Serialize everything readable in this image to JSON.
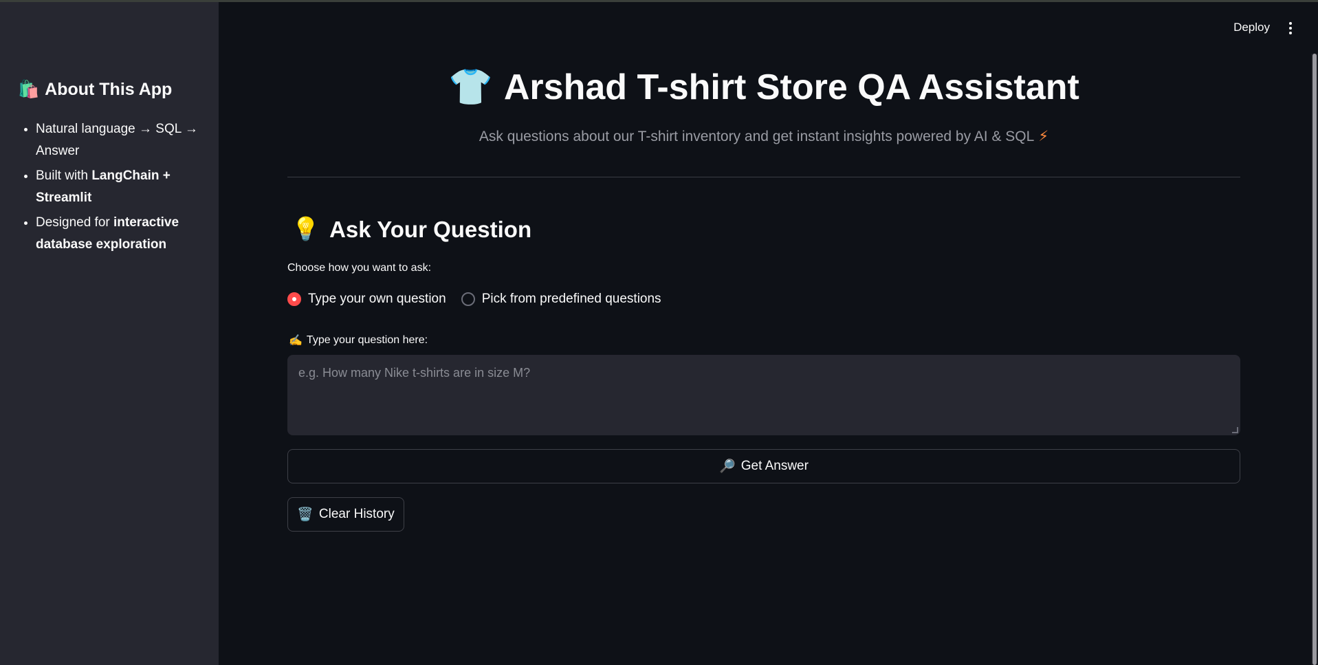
{
  "sidebar": {
    "title_icon": "🛍️",
    "title": "About This App",
    "items": [
      {
        "text": "Natural language → SQL → Answer",
        "bold": ""
      },
      {
        "text": "Built with ",
        "bold": "LangChain + Streamlit"
      },
      {
        "text": "Designed for ",
        "bold": "interactive database exploration"
      }
    ]
  },
  "header": {
    "deploy_label": "Deploy",
    "menu_icon": "kebab-menu-icon"
  },
  "main": {
    "title_icon": "👕",
    "title": "Arshad T-shirt Store QA Assistant",
    "subtitle": "Ask questions about our T-shirt inventory and get instant insights powered by AI & SQL",
    "subtitle_icon": "⚡",
    "section_icon": "💡",
    "section_title": "Ask Your Question",
    "radio_label": "Choose how you want to ask:",
    "radio_options": [
      {
        "label": "Type your own question",
        "selected": true
      },
      {
        "label": "Pick from predefined questions",
        "selected": false
      }
    ],
    "input_icon": "✍️",
    "input_label": "Type your question here:",
    "input_placeholder": "e.g. How many Nike t-shirts are in size M?",
    "input_value": "",
    "get_answer_icon": "🔎",
    "get_answer_label": "Get Answer",
    "clear_icon": "🗑️",
    "clear_label": "Clear History"
  },
  "colors": {
    "background": "#0e1117",
    "sidebar": "#262730",
    "accent": "#ff4b4b"
  }
}
